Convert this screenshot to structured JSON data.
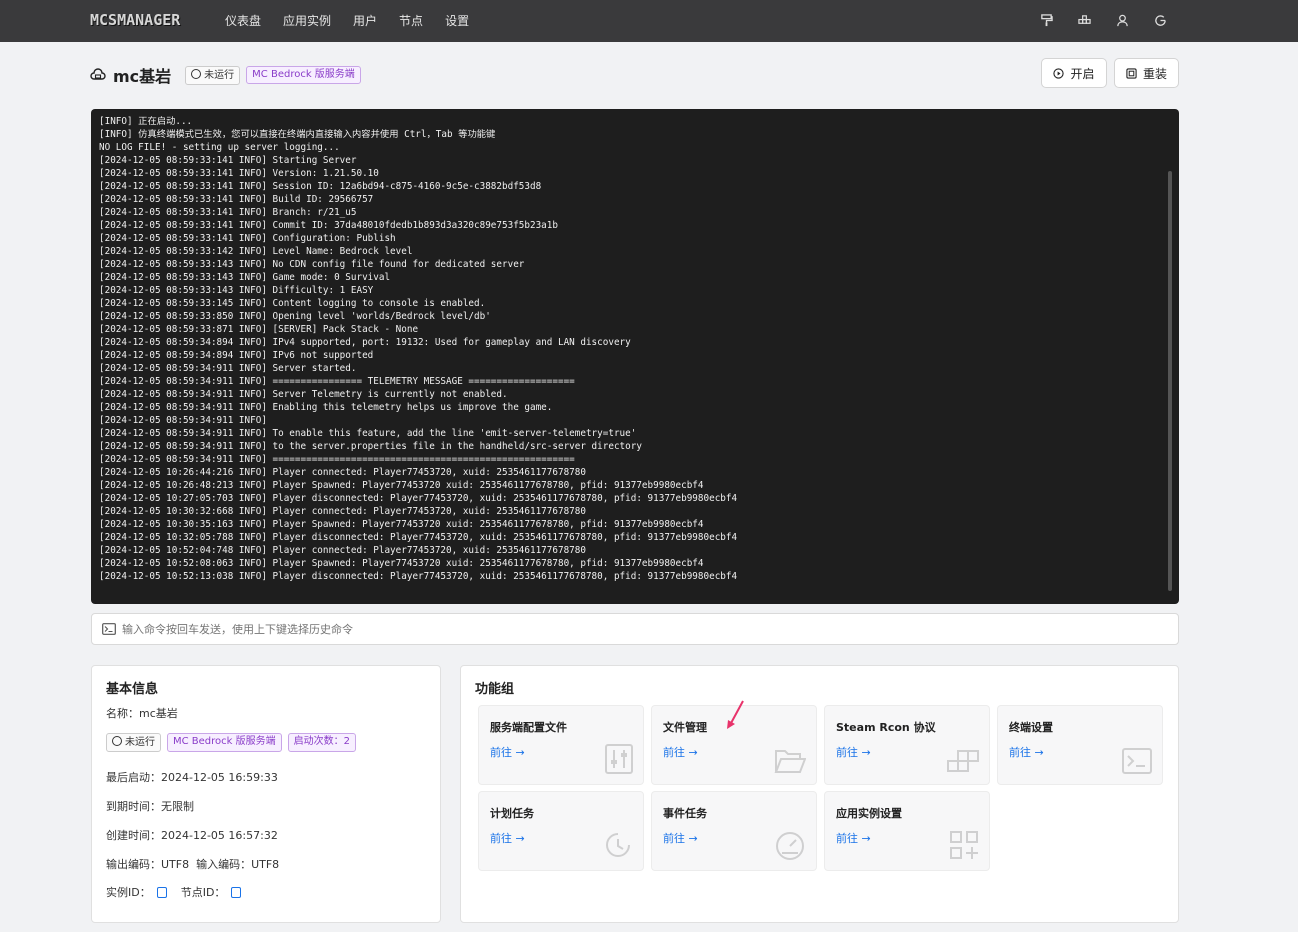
{
  "nav": {
    "logo": "MCSMANAGER",
    "items": [
      "仪表盘",
      "应用实例",
      "用户",
      "节点",
      "设置"
    ],
    "icons": [
      "paint-roller-icon",
      "apps-icon",
      "user-icon",
      "logout-icon"
    ]
  },
  "header": {
    "title": "mc基岩",
    "status": "未运行",
    "type": "MC Bedrock 版服务端",
    "start_button": "开启",
    "reinstall_button": "重装"
  },
  "terminal": {
    "lines": [
      "[INFO] 正在启动...",
      "[INFO] 仿真终端模式已生效，您可以直接在终端内直接输入内容并使用 Ctrl，Tab 等功能键",
      "NO LOG FILE! - setting up server logging...",
      "[2024-12-05 08:59:33:141 INFO] Starting Server",
      "[2024-12-05 08:59:33:141 INFO] Version: 1.21.50.10",
      "[2024-12-05 08:59:33:141 INFO] Session ID: 12a6bd94-c875-4160-9c5e-c3882bdf53d8",
      "[2024-12-05 08:59:33:141 INFO] Build ID: 29566757",
      "[2024-12-05 08:59:33:141 INFO] Branch: r/21_u5",
      "[2024-12-05 08:59:33:141 INFO] Commit ID: 37da48010fdedb1b893d3a320c89e753f5b23a1b",
      "[2024-12-05 08:59:33:141 INFO] Configuration: Publish",
      "[2024-12-05 08:59:33:142 INFO] Level Name: Bedrock level",
      "[2024-12-05 08:59:33:143 INFO] No CDN config file found for dedicated server",
      "[2024-12-05 08:59:33:143 INFO] Game mode: 0 Survival",
      "[2024-12-05 08:59:33:143 INFO] Difficulty: 1 EASY",
      "[2024-12-05 08:59:33:145 INFO] Content logging to console is enabled.",
      "[2024-12-05 08:59:33:850 INFO] Opening level 'worlds/Bedrock level/db'",
      "[2024-12-05 08:59:33:871 INFO] [SERVER] Pack Stack - None",
      "[2024-12-05 08:59:34:894 INFO] IPv4 supported, port: 19132: Used for gameplay and LAN discovery",
      "[2024-12-05 08:59:34:894 INFO] IPv6 not supported",
      "[2024-12-05 08:59:34:911 INFO] Server started.",
      "[2024-12-05 08:59:34:911 INFO] ================ TELEMETRY MESSAGE ===================",
      "[2024-12-05 08:59:34:911 INFO] Server Telemetry is currently not enabled.",
      "[2024-12-05 08:59:34:911 INFO] Enabling this telemetry helps us improve the game.",
      "[2024-12-05 08:59:34:911 INFO]",
      "[2024-12-05 08:59:34:911 INFO] To enable this feature, add the line 'emit-server-telemetry=true'",
      "[2024-12-05 08:59:34:911 INFO] to the server.properties file in the handheld/src-server directory",
      "[2024-12-05 08:59:34:911 INFO] ======================================================",
      "[2024-12-05 10:26:44:216 INFO] Player connected: Player77453720, xuid: 2535461177678780",
      "[2024-12-05 10:26:48:213 INFO] Player Spawned: Player77453720 xuid: 2535461177678780, pfid: 91377eb9980ecbf4",
      "[2024-12-05 10:27:05:703 INFO] Player disconnected: Player77453720, xuid: 2535461177678780, pfid: 91377eb9980ecbf4",
      "[2024-12-05 10:30:32:668 INFO] Player connected: Player77453720, xuid: 2535461177678780",
      "[2024-12-05 10:30:35:163 INFO] Player Spawned: Player77453720 xuid: 2535461177678780, pfid: 91377eb9980ecbf4",
      "[2024-12-05 10:32:05:788 INFO] Player disconnected: Player77453720, xuid: 2535461177678780, pfid: 91377eb9980ecbf4",
      "[2024-12-05 10:52:04:748 INFO] Player connected: Player77453720, xuid: 2535461177678780",
      "[2024-12-05 10:52:08:063 INFO] Player Spawned: Player77453720 xuid: 2535461177678780, pfid: 91377eb9980ecbf4",
      "[2024-12-05 10:52:13:038 INFO] Player disconnected: Player77453720, xuid: 2535461177678780, pfid: 91377eb9980ecbf4"
    ]
  },
  "command": {
    "placeholder": "输入命令按回车发送，使用上下键选择历史命令"
  },
  "basic_info": {
    "title": "基本信息",
    "name": "名称：mc基岩",
    "status": "未运行",
    "type": "MC Bedrock 版服务端",
    "start_count": "启动次数：2",
    "last_start": "最后启动：2024-12-05 16:59:33",
    "expire": "到期时间：无限制",
    "created": "创建时间：2024-12-05 16:57:32",
    "encoding": "输出编码：UTF8  输入编码：UTF8",
    "instance_id_label": "实例ID：",
    "node_id_label": "节点ID："
  },
  "features": {
    "title": "功能组",
    "go": "前往",
    "items": [
      {
        "title": "服务端配置文件",
        "icon": "sliders-icon"
      },
      {
        "title": "文件管理",
        "icon": "folder-open-icon"
      },
      {
        "title": "Steam Rcon 协议",
        "icon": "blocks-icon"
      },
      {
        "title": "终端设置",
        "icon": "terminal-icon"
      },
      {
        "title": "计划任务",
        "icon": "clock-history-icon"
      },
      {
        "title": "事件任务",
        "icon": "dashboard-icon"
      },
      {
        "title": "应用实例设置",
        "icon": "app-settings-icon"
      }
    ]
  },
  "colors": {
    "topbar": "#3a3a3c",
    "terminal_bg": "#1e1e1e",
    "link": "#1a73e8",
    "purple_badge": "#8a3cc9"
  }
}
